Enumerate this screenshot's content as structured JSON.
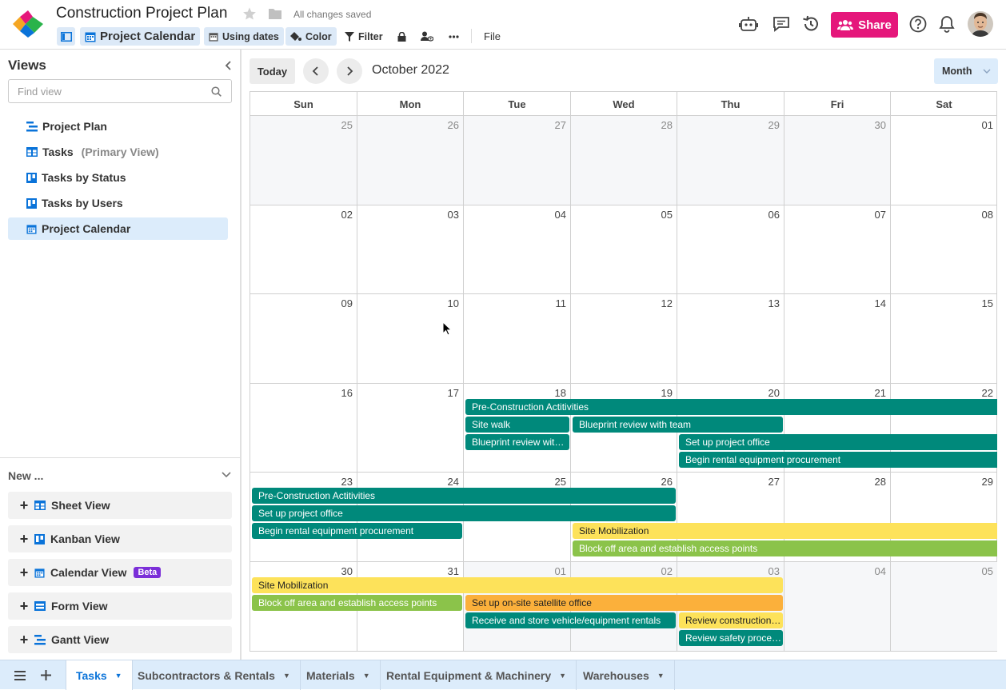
{
  "header": {
    "title": "Construction Project Plan",
    "save_status": "All changes saved",
    "toolbar": {
      "view_name": "Project Calendar",
      "using_dates": "Using dates",
      "color": "Color",
      "filter": "Filter",
      "file": "File"
    },
    "share_label": "Share",
    "accent_color": "#e5177b"
  },
  "sidebar": {
    "title": "Views",
    "search_placeholder": "Find view",
    "views": [
      {
        "label": "Project Plan",
        "icon": "gantt-icon"
      },
      {
        "label": "Tasks",
        "suffix": "(Primary View)",
        "icon": "grid-icon"
      },
      {
        "label": "Tasks by Status",
        "icon": "kanban-icon"
      },
      {
        "label": "Tasks by Users",
        "icon": "kanban-icon"
      },
      {
        "label": "Project Calendar",
        "icon": "calendar-icon",
        "active": true
      }
    ],
    "new_title": "New ...",
    "new_items": [
      {
        "label": "Sheet View",
        "icon": "grid-icon"
      },
      {
        "label": "Kanban View",
        "icon": "kanban-icon"
      },
      {
        "label": "Calendar View",
        "icon": "calendar-icon",
        "badge": "Beta"
      },
      {
        "label": "Form View",
        "icon": "form-icon"
      },
      {
        "label": "Gantt View",
        "icon": "gantt-icon"
      }
    ]
  },
  "calendar": {
    "today_label": "Today",
    "month_label": "October 2022",
    "view_mode": "Month",
    "weekdays": [
      "Sun",
      "Mon",
      "Tue",
      "Wed",
      "Thu",
      "Fri",
      "Sat"
    ],
    "weeks": [
      [
        "25",
        "26",
        "27",
        "28",
        "29",
        "30",
        "01"
      ],
      [
        "02",
        "03",
        "04",
        "05",
        "06",
        "07",
        "08"
      ],
      [
        "09",
        "10",
        "11",
        "12",
        "13",
        "14",
        "15"
      ],
      [
        "16",
        "17",
        "18",
        "19",
        "20",
        "21",
        "22"
      ],
      [
        "23",
        "24",
        "25",
        "26",
        "27",
        "28",
        "29"
      ],
      [
        "30",
        "31",
        "01",
        "02",
        "03",
        "04",
        "05"
      ]
    ],
    "events": [
      {
        "week": 3,
        "lane": 0,
        "start": 2,
        "end": 6,
        "label": "Pre-Construction Actitivities",
        "color": "teal"
      },
      {
        "week": 3,
        "lane": 1,
        "start": 2,
        "end": 2,
        "label": "Site walk",
        "color": "teal"
      },
      {
        "week": 3,
        "lane": 1,
        "start": 3,
        "end": 4,
        "label": "Blueprint review with team",
        "color": "teal"
      },
      {
        "week": 3,
        "lane": 2,
        "start": 2,
        "end": 2,
        "label": "Blueprint review with team",
        "color": "teal"
      },
      {
        "week": 3,
        "lane": 2,
        "start": 4,
        "end": 6,
        "label": "Set up project office",
        "color": "teal"
      },
      {
        "week": 3,
        "lane": 3,
        "start": 4,
        "end": 6,
        "label": "Begin rental equipment procurement",
        "color": "teal"
      },
      {
        "week": 4,
        "lane": 0,
        "start": 0,
        "end": 3,
        "label": "Pre-Construction Actitivities",
        "color": "teal"
      },
      {
        "week": 4,
        "lane": 1,
        "start": 0,
        "end": 3,
        "label": "Set up project office",
        "color": "teal"
      },
      {
        "week": 4,
        "lane": 2,
        "start": 0,
        "end": 1,
        "label": "Begin rental equipment procurement",
        "color": "teal"
      },
      {
        "week": 4,
        "lane": 2,
        "start": 3,
        "end": 6,
        "label": "Site Mobilization",
        "color": "yellow"
      },
      {
        "week": 4,
        "lane": 3,
        "start": 3,
        "end": 6,
        "label": "Block off area and establish access points",
        "color": "green"
      },
      {
        "week": 5,
        "lane": 0,
        "start": 0,
        "end": 4,
        "label": "Site Mobilization",
        "color": "yellow"
      },
      {
        "week": 5,
        "lane": 1,
        "start": 0,
        "end": 1,
        "label": "Block off area and establish access points",
        "color": "green"
      },
      {
        "week": 5,
        "lane": 1,
        "start": 2,
        "end": 4,
        "label": "Set up on-site satellite office",
        "color": "orange"
      },
      {
        "week": 5,
        "lane": 2,
        "start": 2,
        "end": 3,
        "label": "Receive and store vehicle/equipment rentals",
        "color": "teal"
      },
      {
        "week": 5,
        "lane": 2,
        "start": 4,
        "end": 4,
        "label": "Review construction plans",
        "color": "yellow"
      },
      {
        "week": 5,
        "lane": 3,
        "start": 4,
        "end": 4,
        "label": "Review safety procedures",
        "color": "teal"
      }
    ]
  },
  "sheet_tabs": [
    {
      "label": "Tasks",
      "active": true
    },
    {
      "label": "Subcontractors & Rentals"
    },
    {
      "label": "Materials"
    },
    {
      "label": "Rental Equipment & Machinery"
    },
    {
      "label": "Warehouses"
    }
  ]
}
